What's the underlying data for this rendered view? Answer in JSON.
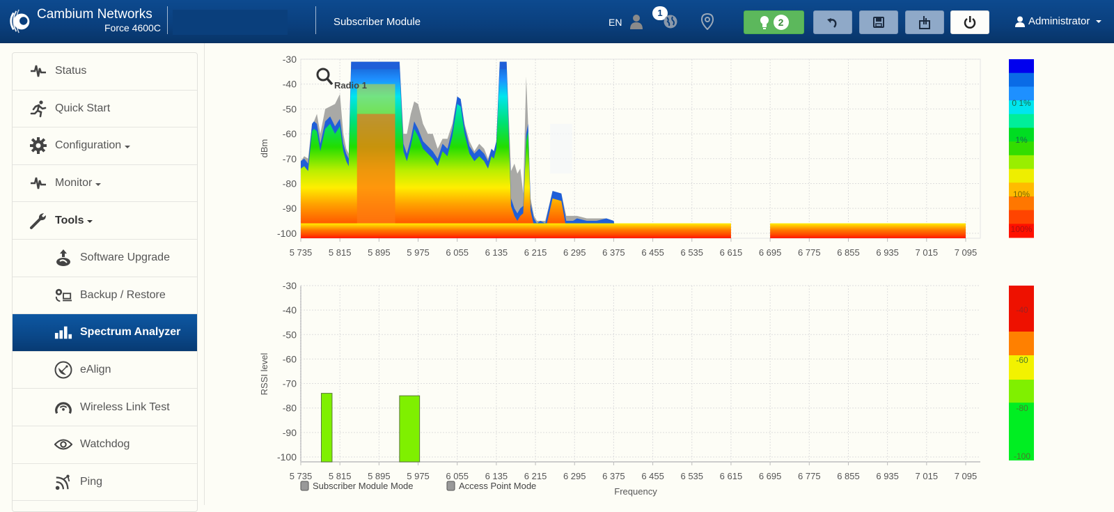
{
  "header": {
    "brand": "Cambium Networks",
    "model": "Force 4600C",
    "device_name": "",
    "mode": "Subscriber Module",
    "language": "EN",
    "user_badge_count": "1",
    "alarm_count": "2",
    "user": "Administrator",
    "icons": {
      "users": "user-icon",
      "globe": "globe-icon",
      "location": "map-marker-icon",
      "alarms": "lightbulb-icon",
      "undo": "undo-icon",
      "save": "floppy-disk-icon",
      "tools": "reboot-tools-icon",
      "power": "power-icon",
      "user_menu": "user-icon"
    }
  },
  "sidebar": {
    "items": [
      {
        "label": "Status",
        "icon": "heartbeat-icon",
        "dropdown": false,
        "level": 0,
        "active": false
      },
      {
        "label": "Quick Start",
        "icon": "running-man-icon",
        "dropdown": false,
        "level": 0,
        "active": false
      },
      {
        "label": "Configuration",
        "icon": "gear-icon",
        "dropdown": true,
        "level": 0,
        "active": false
      },
      {
        "label": "Monitor",
        "icon": "heartbeat-icon",
        "dropdown": true,
        "level": 0,
        "active": false
      },
      {
        "label": "Tools",
        "icon": "wrench-icon",
        "dropdown": true,
        "level": 0,
        "active": false,
        "bold": true
      },
      {
        "label": "Software Upgrade",
        "icon": "upload-icon",
        "dropdown": false,
        "level": 1,
        "active": false
      },
      {
        "label": "Backup / Restore",
        "icon": "backup-icon",
        "dropdown": false,
        "level": 1,
        "active": false
      },
      {
        "label": "Spectrum Analyzer",
        "icon": "bar-chart-icon",
        "dropdown": false,
        "level": 1,
        "active": true
      },
      {
        "label": "eAlign",
        "icon": "satellite-dish-icon",
        "dropdown": false,
        "level": 1,
        "active": false
      },
      {
        "label": "Wireless Link Test",
        "icon": "gauge-icon",
        "dropdown": false,
        "level": 1,
        "active": false
      },
      {
        "label": "Watchdog",
        "icon": "eye-icon",
        "dropdown": false,
        "level": 1,
        "active": false
      },
      {
        "label": "Ping",
        "icon": "ping-icon",
        "dropdown": false,
        "level": 1,
        "active": false
      }
    ]
  },
  "chart_data": [
    {
      "type": "heatmap",
      "title": "Radio 1",
      "xlabel": "",
      "ylabel": "dBm",
      "xlim": [
        5735,
        7095
      ],
      "ylim": [
        -102,
        -30
      ],
      "x_ticks": [
        "5 735",
        "5 815",
        "5 895",
        "5 975",
        "6 055",
        "6 135",
        "6 215",
        "6 295",
        "6 375",
        "6 455",
        "6 535",
        "6 615",
        "6 695",
        "6 775",
        "6 855",
        "6 935",
        "7 015",
        "7 095"
      ],
      "y_ticks": [
        "-30",
        "-40",
        "-50",
        "-60",
        "-70",
        "-80",
        "-90",
        "-100"
      ],
      "grid": true,
      "colorscale_labels": [
        "0 1%",
        "1%",
        "10%",
        "100%"
      ],
      "colorscale_colors": [
        "#0000ee",
        "#0a6be6",
        "#1e90ff",
        "#00e5ee",
        "#00ee99",
        "#00dd22",
        "#33dd00",
        "#99ee00",
        "#eeee00",
        "#ffbb00",
        "#ff7700",
        "#ff4400",
        "#ff1100"
      ],
      "envelope": {
        "description": "Upper envelope of observed signal (dBm) per frequency (MHz)",
        "x": [
          5735,
          5742,
          5750,
          5758,
          5762,
          5768,
          5775,
          5785,
          5795,
          5805,
          5815,
          5822,
          5828,
          5833,
          5838,
          5848,
          5860,
          5880,
          5900,
          5915,
          5930,
          5937,
          5945,
          5952,
          5960,
          5967,
          5975,
          5985,
          5995,
          6005,
          6015,
          6025,
          6035,
          6045,
          6055,
          6062,
          6070,
          6080,
          6090,
          6100,
          6110,
          6118,
          6125,
          6130,
          6135,
          6142,
          6148,
          6156,
          6165,
          6172,
          6178,
          6184,
          6190,
          6196,
          6200,
          6205,
          6212,
          6218,
          6225,
          6235,
          6250,
          6268,
          6278,
          6285,
          6292,
          6300,
          6320,
          6340,
          6360,
          6375,
          6376,
          6615,
          6695,
          7095
        ],
        "max": [
          -71,
          -70,
          -72,
          -56,
          -55,
          -56,
          -64,
          -55,
          -53,
          -57,
          -54,
          -64,
          -68,
          -70,
          -31,
          -31,
          -31,
          -31,
          -31,
          -31,
          -31,
          -31,
          -64,
          -68,
          -62,
          -55,
          -58,
          -63,
          -65,
          -67,
          -70,
          -64,
          -66,
          -58,
          -45,
          -46,
          -57,
          -65,
          -68,
          -66,
          -68,
          -71,
          -66,
          -67,
          -63,
          -31,
          -31,
          -31,
          -86,
          -90,
          -92,
          -90,
          -89,
          -60,
          -56,
          -88,
          -94,
          -96,
          -95,
          -96,
          -83,
          -84,
          -95,
          -95,
          -95,
          -94,
          -95,
          -95,
          -94,
          -95,
          -96,
          -96,
          -96,
          -96
        ],
        "peak_hold": [
          -71,
          -69,
          -70,
          -56,
          -55,
          -52,
          -60,
          -50,
          -49,
          -48,
          -44,
          -60,
          -66,
          -68,
          -31,
          -31,
          -31,
          -31,
          -31,
          -31,
          -31,
          -31,
          -60,
          -60,
          -52,
          -47,
          -48,
          -56,
          -60,
          -60,
          -66,
          -62,
          -62,
          -56,
          -45,
          -46,
          -56,
          -63,
          -67,
          -64,
          -66,
          -70,
          -66,
          -67,
          -63,
          -31,
          -31,
          -31,
          -75,
          -72,
          -76,
          -74,
          -84,
          -37,
          -56,
          -86,
          -93,
          -95,
          -95,
          -95,
          -83,
          -84,
          -93,
          -93,
          -93,
          -93,
          -94,
          -94,
          -94,
          -95,
          -96,
          -96,
          -96,
          -96
        ]
      },
      "no_data_ranges": [
        [
          6615,
          6695
        ]
      ]
    },
    {
      "type": "bar",
      "xlabel": "Frequency",
      "ylabel": "RSSI level",
      "xlim": [
        5735,
        7095
      ],
      "ylim": [
        -102,
        -30
      ],
      "x_ticks": [
        "5 735",
        "5 815",
        "5 895",
        "5 975",
        "6 055",
        "6 135",
        "6 215",
        "6 295",
        "6 375",
        "6 455",
        "6 535",
        "6 615",
        "6 695",
        "6 775",
        "6 855",
        "6 935",
        "7 015",
        "7 095"
      ],
      "y_ticks": [
        "-30",
        "-40",
        "-50",
        "-60",
        "-70",
        "-80",
        "-90",
        "-100"
      ],
      "grid": true,
      "bars": [
        {
          "x_start": 5777,
          "x_end": 5799,
          "value": -74,
          "color": "#7ff000"
        },
        {
          "x_start": 5937,
          "x_end": 5978,
          "value": -75,
          "color": "#7ff000"
        }
      ],
      "legend": [
        {
          "label": "Subscriber Module Mode",
          "checked": false
        },
        {
          "label": "Access Point Mode",
          "checked": false
        }
      ],
      "legend_position": "bottom-left",
      "colorscale_labels": [
        "-40",
        "-60",
        "-80",
        "-100"
      ],
      "colorscale_colors": [
        "#ee1100",
        "#ff8000",
        "#f2f200",
        "#80f000",
        "#00ee22"
      ]
    }
  ]
}
